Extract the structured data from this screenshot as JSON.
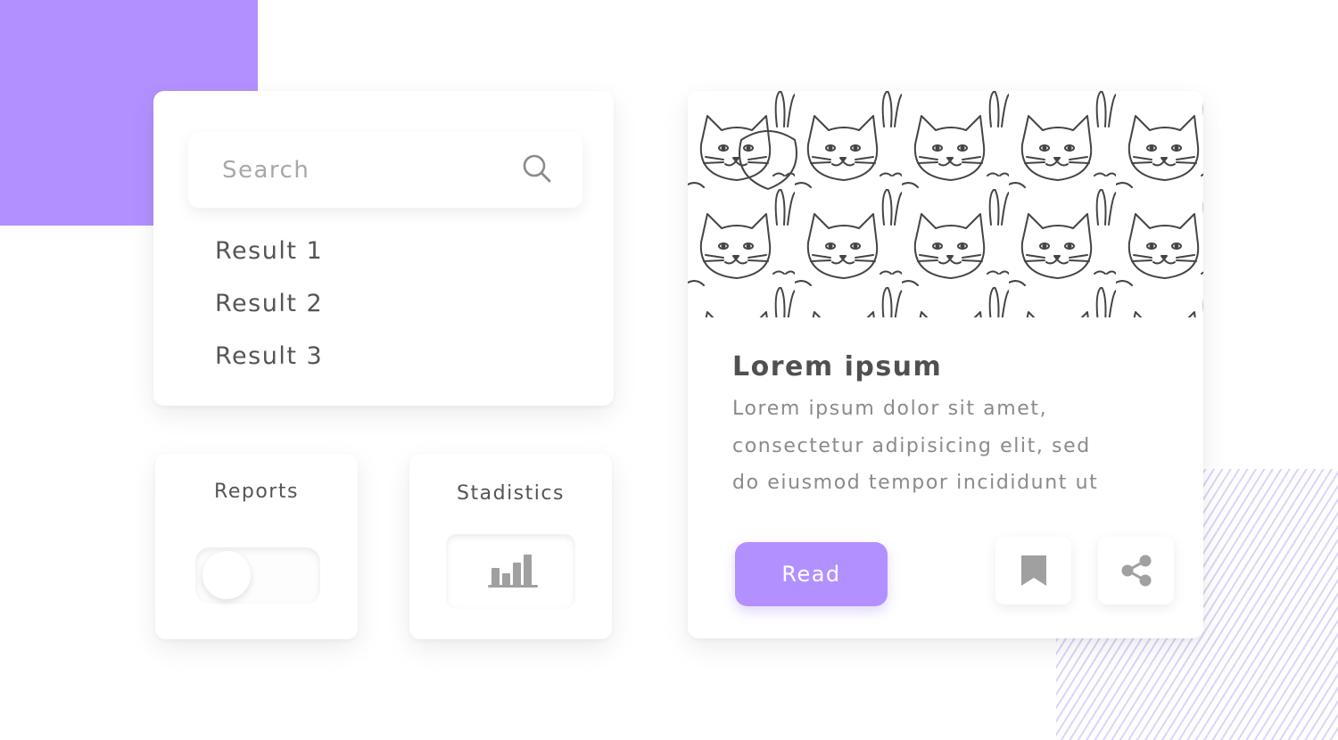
{
  "colors": {
    "accent": "#b390ff",
    "icon_gray": "#a0a0a0",
    "text_dark": "#555555",
    "text_muted": "#8a8a8a"
  },
  "search": {
    "placeholder": "Search",
    "value": "",
    "icon": "search-icon",
    "results": [
      {
        "label": "Result 1"
      },
      {
        "label": "Result 2"
      },
      {
        "label": "Result 3"
      }
    ]
  },
  "reports": {
    "title": "Reports",
    "toggle_on": false
  },
  "statistics": {
    "title": "Stadistics",
    "icon": "bar-chart-icon"
  },
  "article": {
    "image_alt": "Line drawing of many cats, dogs, rabbits and birds",
    "title": "Lorem ipsum",
    "body_lines": [
      "Lorem ipsum dolor sit amet,",
      "consectetur adipisicing elit, sed",
      "do eiusmod tempor incididunt ut"
    ],
    "read_label": "Read",
    "bookmark_icon": "bookmark-icon",
    "share_icon": "share-icon"
  }
}
